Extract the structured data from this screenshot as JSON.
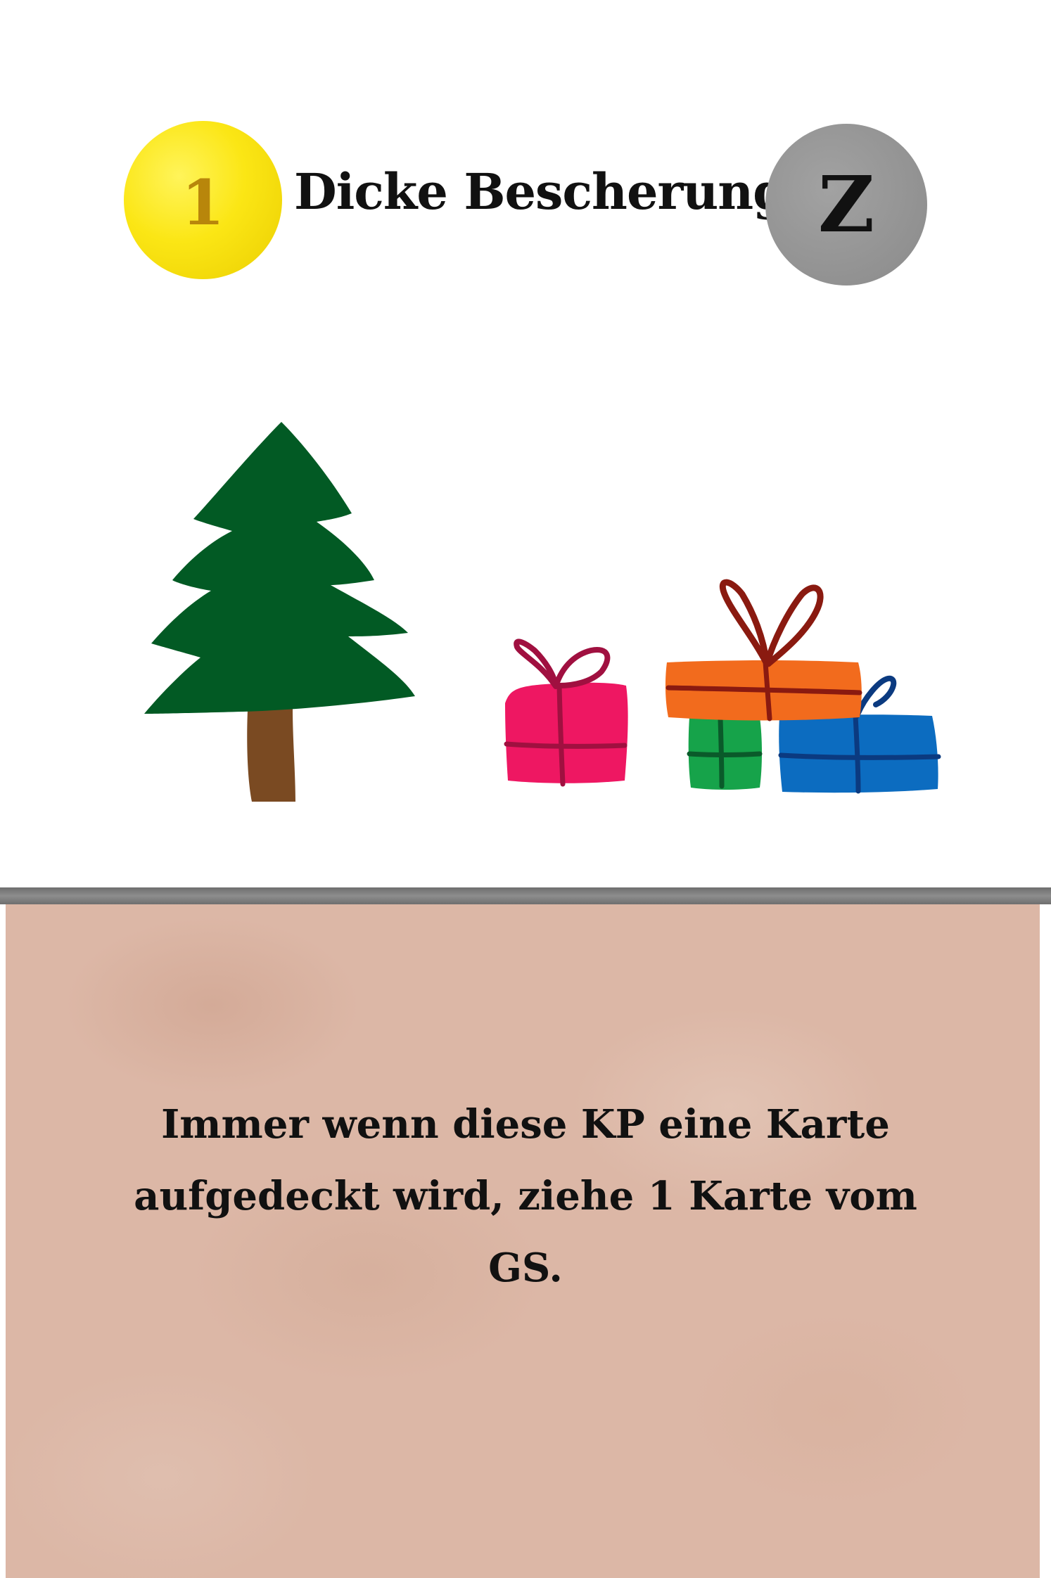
{
  "card": {
    "cost": "1",
    "title": "Dicke Bescherung",
    "type": "Z",
    "rule_text": "Immer wenn diese KP eine Karte aufgedeckt wird, ziehe 1 Karte vom GS."
  },
  "colors": {
    "cost_coin": "#fbe615",
    "cost_text": "#b8860b",
    "type_coin": "#969696",
    "text_box": "#dcb7a6",
    "tree_green": "#025a24",
    "tree_trunk": "#7a4a22"
  },
  "illustration": {
    "icons": [
      "christmas-tree-icon",
      "gift-pink-icon",
      "gift-orange-icon",
      "gift-green-icon",
      "gift-blue-icon"
    ]
  }
}
